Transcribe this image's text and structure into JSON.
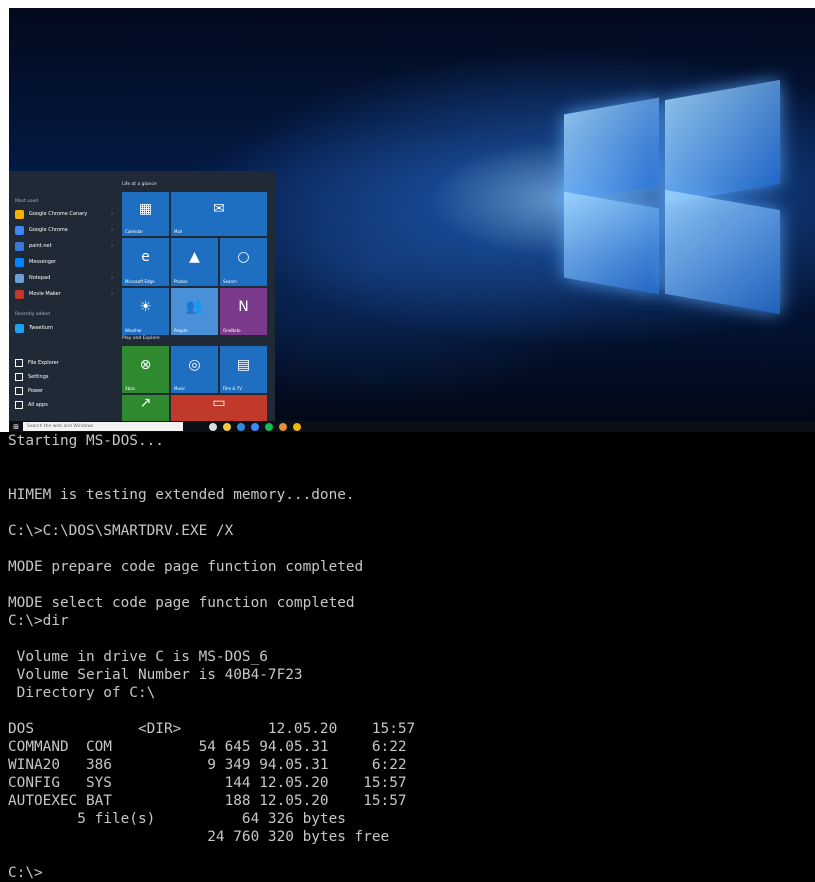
{
  "start_menu": {
    "most_used_header": "Most used",
    "most_used": [
      {
        "label": "Google Chrome Canary",
        "icon": "chrome-canary-icon",
        "color": "#f4b400",
        "has_submenu": true
      },
      {
        "label": "Google Chrome",
        "icon": "chrome-icon",
        "color": "#4285f4",
        "has_submenu": true
      },
      {
        "label": "paint.net",
        "icon": "paintnet-icon",
        "color": "#3a7bd5",
        "has_submenu": true
      },
      {
        "label": "Messenger",
        "icon": "messenger-icon",
        "color": "#0084ff",
        "has_submenu": false
      },
      {
        "label": "Notepad",
        "icon": "notepad-icon",
        "color": "#6aa0d8",
        "has_submenu": true
      },
      {
        "label": "Movie Maker",
        "icon": "movie-maker-icon",
        "color": "#c0392b",
        "has_submenu": true
      }
    ],
    "recently_added_header": "Recently added",
    "recently_added": [
      {
        "label": "Tweetium",
        "icon": "tweetium-icon",
        "color": "#1da1f2"
      }
    ],
    "bottom": [
      {
        "label": "File Explorer",
        "icon": "folder-icon"
      },
      {
        "label": "Settings",
        "icon": "gear-icon"
      },
      {
        "label": "Power",
        "icon": "power-icon"
      },
      {
        "label": "All apps",
        "icon": "list-icon"
      }
    ],
    "groups": {
      "life": "Life at a glance",
      "play": "Play and Explore"
    },
    "tiles": [
      {
        "label": "Calendar",
        "icon": "calendar-icon",
        "glyph": "▦",
        "color": "#1e6fc2"
      },
      {
        "label": "Mail",
        "icon": "mail-icon",
        "glyph": "✉",
        "color": "#1e6fc2"
      },
      {
        "label": "Microsoft Edge",
        "icon": "edge-icon",
        "glyph": "e",
        "color": "#1e6fc2"
      },
      {
        "label": "Photos",
        "icon": "photos-icon",
        "glyph": "▲",
        "color": "#1e6fc2"
      },
      {
        "label": "Search",
        "icon": "search-icon",
        "glyph": "○",
        "color": "#1e6fc2"
      },
      {
        "label": "Weather",
        "icon": "weather-icon",
        "glyph": "☀",
        "color": "#1e6fc2"
      },
      {
        "label": "People",
        "icon": "people-icon",
        "glyph": "👥",
        "color": "#4a90d9"
      },
      {
        "label": "OneNote",
        "icon": "onenote-icon",
        "glyph": "N",
        "color": "#7b3a8c"
      },
      {
        "label": "Xbox",
        "icon": "xbox-icon",
        "glyph": "⊗",
        "color": "#2f8a2f"
      },
      {
        "label": "Music",
        "icon": "music-icon",
        "glyph": "◎",
        "color": "#1e6fc2"
      },
      {
        "label": "Film & TV",
        "icon": "film-icon",
        "glyph": "▤",
        "color": "#1e6fc2"
      },
      {
        "label": "",
        "icon": "money-icon",
        "glyph": "↗",
        "color": "#2f8a2f"
      },
      {
        "label": "",
        "icon": "news-icon",
        "glyph": "▭",
        "color": "#c0392b"
      }
    ]
  },
  "taskbar": {
    "search_placeholder": "Search the web and Windows",
    "icons": [
      {
        "icon": "task-view-icon",
        "color": "#dddddd"
      },
      {
        "icon": "file-explorer-icon",
        "color": "#f2c744"
      },
      {
        "icon": "edge-taskbar-icon",
        "color": "#2d8fe0"
      },
      {
        "icon": "chrome-taskbar-icon",
        "color": "#4285f4"
      },
      {
        "icon": "spotify-icon",
        "color": "#1db954"
      },
      {
        "icon": "paint-icon",
        "color": "#e58f3a"
      },
      {
        "icon": "chrome-canary-taskbar-icon",
        "color": "#f4b400"
      }
    ]
  },
  "dos": {
    "lines": [
      "Starting MS-DOS...",
      "",
      "",
      "HIMEM is testing extended memory...done.",
      "",
      "C:\\>C:\\DOS\\SMARTDRV.EXE /X",
      "",
      "MODE prepare code page function completed",
      "",
      "MODE select code page function completed",
      "C:\\>dir",
      "",
      " Volume in drive C is MS-DOS_6",
      " Volume Serial Number is 40B4-7F23",
      " Directory of C:\\",
      "",
      "DOS            <DIR>          12.05.20    15:57",
      "COMMAND  COM          54 645 94.05.31     6:22",
      "WINA20   386           9 349 94.05.31     6:22",
      "CONFIG   SYS             144 12.05.20    15:57",
      "AUTOEXEC BAT             188 12.05.20    15:57",
      "        5 file(s)          64 326 bytes",
      "                       24 760 320 bytes free",
      "",
      "C:\\>"
    ]
  }
}
